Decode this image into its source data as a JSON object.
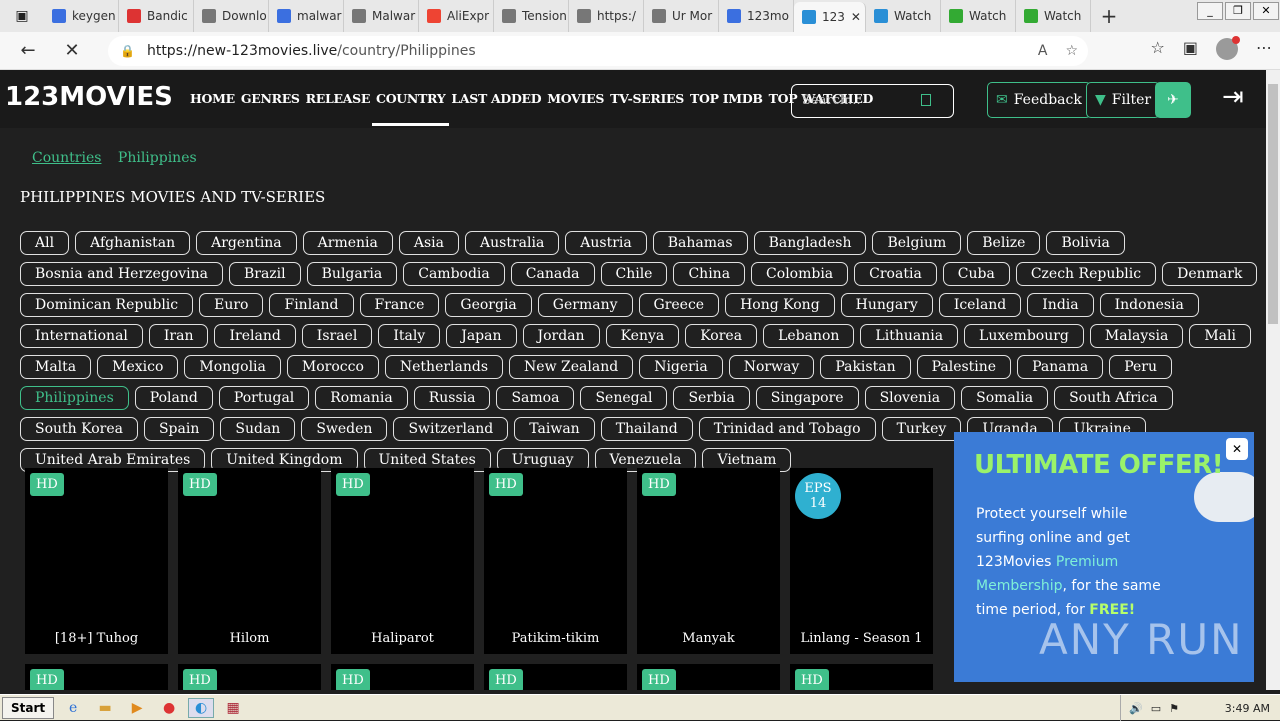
{
  "browser": {
    "tabs": [
      {
        "label": "keygen",
        "fav": "#3b6fe0"
      },
      {
        "label": "Bandic",
        "fav": "#d33"
      },
      {
        "label": "Downlo",
        "fav": "#777"
      },
      {
        "label": "malwar",
        "fav": "#3b6fe0"
      },
      {
        "label": "Malwar",
        "fav": "#777"
      },
      {
        "label": "AliExpr",
        "fav": "#e43"
      },
      {
        "label": "Tension",
        "fav": "#777"
      },
      {
        "label": "https:/",
        "fav": "#777"
      },
      {
        "label": "Ur Mor",
        "fav": "#777"
      },
      {
        "label": "123mo",
        "fav": "#3b6fe0"
      },
      {
        "label": "123",
        "fav": "#2a8fd6",
        "active": true
      },
      {
        "label": "Watch",
        "fav": "#2a8fd6"
      },
      {
        "label": "Watch",
        "fav": "#3a3"
      },
      {
        "label": "Watch",
        "fav": "#3a3"
      }
    ],
    "url_host": "https://new-123movies.live",
    "url_path": "/country/Philippines"
  },
  "site": {
    "logo": "123MOVIES",
    "menu": [
      "HOME",
      "GENRES",
      "RELEASE",
      "COUNTRY",
      "LAST ADDED",
      "MOVIES",
      "TV-SERIES",
      "TOP IMDB",
      "TOP WATCHED"
    ],
    "active_menu": "COUNTRY",
    "search_placeholder": "Search...",
    "feedback_label": "Feedback",
    "filter_label": "Filter"
  },
  "breadcrumb": {
    "home_icon": "",
    "sep": "",
    "countries": "Countries",
    "current": "Philippines"
  },
  "page_title": "PHILIPPINES MOVIES AND TV-SERIES",
  "countries": [
    "All",
    "Afghanistan",
    "Argentina",
    "Armenia",
    "Asia",
    "Australia",
    "Austria",
    "Bahamas",
    "Bangladesh",
    "Belgium",
    "Belize",
    "Bolivia",
    "Bosnia and Herzegovina",
    "Brazil",
    "Bulgaria",
    "Cambodia",
    "Canada",
    "Chile",
    "China",
    "Colombia",
    "Croatia",
    "Cuba",
    "Czech Republic",
    "Denmark",
    "Dominican Republic",
    "Euro",
    "Finland",
    "France",
    "Georgia",
    "Germany",
    "Greece",
    "Hong Kong",
    "Hungary",
    "Iceland",
    "India",
    "Indonesia",
    "International",
    "Iran",
    "Ireland",
    "Israel",
    "Italy",
    "Japan",
    "Jordan",
    "Kenya",
    "Korea",
    "Lebanon",
    "Lithuania",
    "Luxembourg",
    "Malaysia",
    "Mali",
    "Malta",
    "Mexico",
    "Mongolia",
    "Morocco",
    "Netherlands",
    "New Zealand",
    "Nigeria",
    "Norway",
    "Pakistan",
    "Palestine",
    "Panama",
    "Peru",
    "Philippines",
    "Poland",
    "Portugal",
    "Romania",
    "Russia",
    "Samoa",
    "Senegal",
    "Serbia",
    "Singapore",
    "Slovenia",
    "Somalia",
    "South Africa",
    "South Korea",
    "Spain",
    "Sudan",
    "Sweden",
    "Switzerland",
    "Taiwan",
    "Thailand",
    "Trinidad and Tobago",
    "Turkey",
    "Uganda",
    "Ukraine",
    "United Arab Emirates",
    "United Kingdom",
    "United States",
    "Uruguay",
    "Venezuela",
    "Vietnam"
  ],
  "selected_country": "Philippines",
  "movies": [
    {
      "badge": "HD",
      "title": "[18+] Tuhog"
    },
    {
      "badge": "HD",
      "title": "Hilom"
    },
    {
      "badge": "HD",
      "title": "Haliparot"
    },
    {
      "badge": "HD",
      "title": "Patikim-tikim"
    },
    {
      "badge": "HD",
      "title": "Manyak"
    },
    {
      "badge": "EPS 14",
      "title": "Linlang - Season 1",
      "eps": true
    }
  ],
  "row2_badges": [
    "HD",
    "HD",
    "HD",
    "HD",
    "HD",
    "HD"
  ],
  "ad": {
    "headline": "ULTIMATE OFFER!",
    "line1": "Protect yourself while surfing online and get 123Movies ",
    "highlight": "Premium Membership",
    "line2": ", for the same time period, for ",
    "free": "FREE!",
    "close": "✕",
    "watermark": "ANY RUN"
  },
  "taskbar": {
    "start": "Start",
    "clock": "3:49 AM"
  },
  "colors": {
    "accent": "#3fbf8a",
    "eps": "#2fb0d0",
    "ad_bg": "#3b7bd6"
  }
}
